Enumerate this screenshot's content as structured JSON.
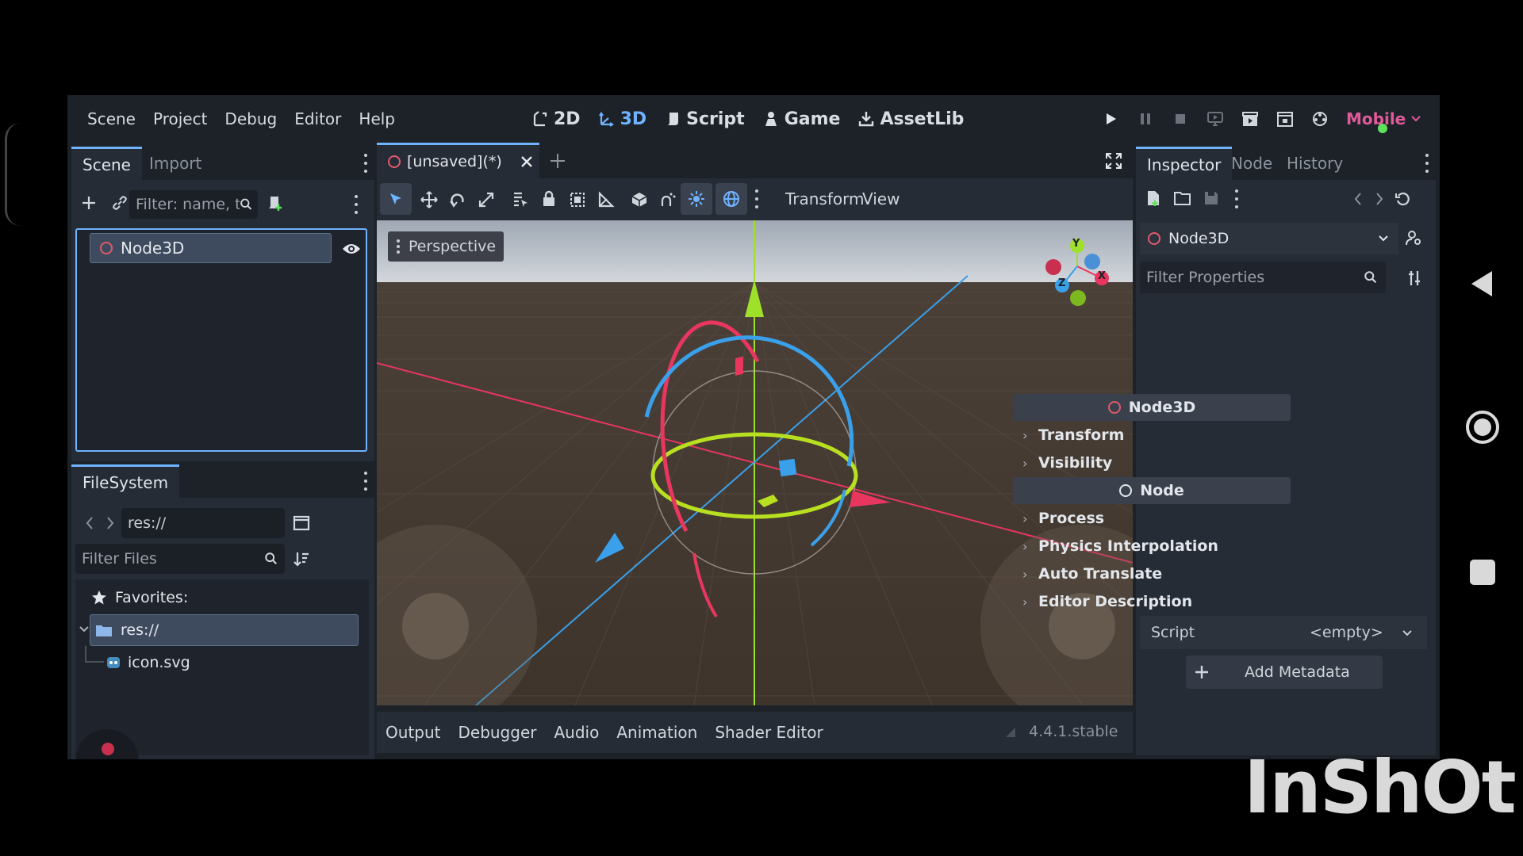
{
  "menu": [
    "Scene",
    "Project",
    "Debug",
    "Editor",
    "Help"
  ],
  "workspaces": [
    {
      "label": "2D",
      "icon": "2d-icon",
      "active": false
    },
    {
      "label": "3D",
      "icon": "3d-icon",
      "active": true
    },
    {
      "label": "Script",
      "icon": "script-icon",
      "active": false
    },
    {
      "label": "Game",
      "icon": "game-icon",
      "active": false
    },
    {
      "label": "AssetLib",
      "icon": "assetlib-icon",
      "active": false
    }
  ],
  "renderer": "Mobile",
  "scene_dock": {
    "tabs": [
      "Scene",
      "Import"
    ],
    "filter_placeholder": "Filter: name, t:ty",
    "root_node": "Node3D"
  },
  "filesystem_dock": {
    "tab": "FileSystem",
    "path": "res://",
    "filter_placeholder": "Filter Files",
    "favorites": "Favorites:",
    "root": "res://",
    "files": [
      "icon.svg"
    ]
  },
  "editor_tab": "[unsaved](*)",
  "viewport": {
    "menus": [
      "Transform",
      "View"
    ],
    "perspective_label": "Perspective",
    "gizmo_axes": [
      "Y",
      "Z",
      "X"
    ]
  },
  "bottom_panel": {
    "tabs": [
      "Output",
      "Debugger",
      "Audio",
      "Animation",
      "Shader Editor"
    ],
    "version": "4.4.1.stable"
  },
  "inspector": {
    "tabs": [
      "Inspector",
      "Node",
      "History"
    ],
    "selected_node": "Node3D",
    "filter_placeholder": "Filter Properties",
    "class_header": "Node3D",
    "class_sections": [
      "Transform",
      "Visibility"
    ],
    "node_header": "Node",
    "node_sections": [
      "Process",
      "Physics Interpolation",
      "Auto Translate",
      "Editor Description"
    ],
    "script_label": "Script",
    "script_value": "<empty>",
    "add_metadata": "Add Metadata"
  },
  "watermark": "InShOt",
  "colors": {
    "accent": "#6fb3ff",
    "x_axis": "#e8365f",
    "y_axis": "#9ee02a",
    "z_axis": "#3aa0ea",
    "node3d_icon": "#e05a6e",
    "renderer": "#e05a9a"
  }
}
